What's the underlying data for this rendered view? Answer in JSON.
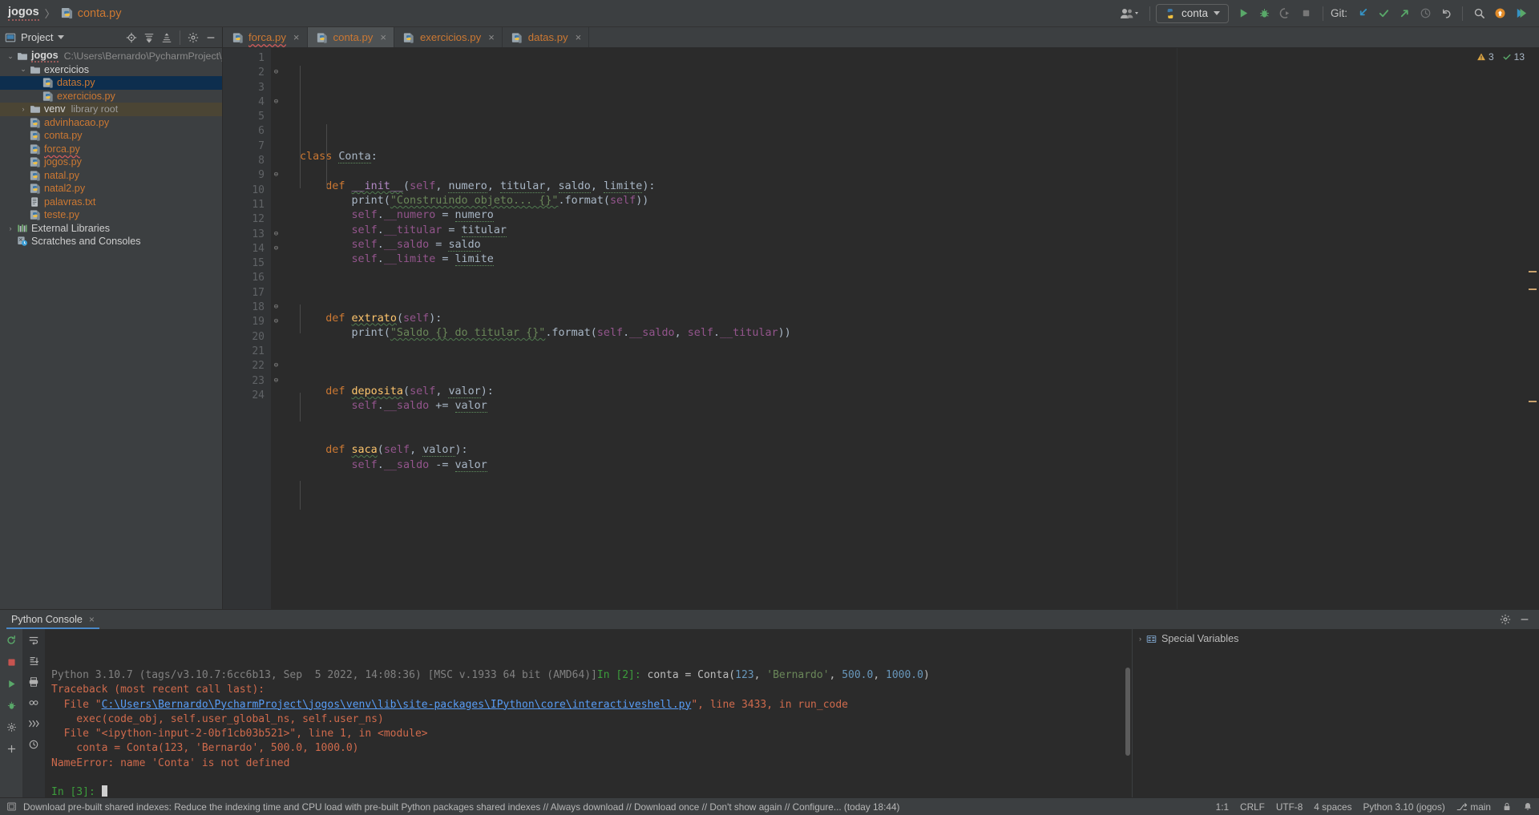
{
  "app": {
    "breadcrumb": {
      "project": "jogos",
      "separator": "〉",
      "file": "conta.py",
      "file_icon": "python-file-icon"
    },
    "run_config": {
      "label": "conta",
      "icon": "python-file-icon"
    },
    "git_label": "Git:",
    "toolbar_icons": [
      "user-account-icon",
      "run-icon",
      "debug-icon",
      "run-coverage-icon",
      "stop-icon",
      "git-update-icon",
      "git-commit-icon",
      "git-push-icon",
      "history-icon",
      "rollback-icon",
      "search-everywhere-icon",
      "notifications-update-icon",
      "plugin-icon"
    ]
  },
  "project_panel": {
    "title": "Project",
    "header_icons": [
      "locate-icon",
      "collapse-all-icon",
      "expand-all-icon",
      "settings-icon",
      "hide-icon"
    ],
    "items": [
      {
        "label": "jogos",
        "sub": "C:\\Users\\Bernardo\\PycharmProject\\jogos",
        "type": "root",
        "icon": "folder-icon",
        "indent": 0,
        "arrow": "⌄",
        "state": "normal"
      },
      {
        "label": "exercicios",
        "sub": "",
        "type": "folder",
        "icon": "folder-icon",
        "indent": 1,
        "arrow": "⌄",
        "state": "normal"
      },
      {
        "label": "datas.py",
        "sub": "",
        "type": "py",
        "icon": "python-file-icon",
        "indent": 2,
        "arrow": "",
        "state": "selected"
      },
      {
        "label": "exercicios.py",
        "sub": "",
        "type": "py",
        "icon": "python-file-icon",
        "indent": 2,
        "arrow": "",
        "state": "normal"
      },
      {
        "label": "venv",
        "sub": "library root",
        "type": "folder",
        "icon": "folder-icon",
        "indent": 1,
        "arrow": "›",
        "state": "highlight"
      },
      {
        "label": "advinhacao.py",
        "sub": "",
        "type": "py",
        "icon": "python-file-icon",
        "indent": 1,
        "arrow": "",
        "state": "normal"
      },
      {
        "label": "conta.py",
        "sub": "",
        "type": "py",
        "icon": "python-file-icon",
        "indent": 1,
        "arrow": "",
        "state": "normal"
      },
      {
        "label": "forca.py",
        "sub": "",
        "type": "py",
        "icon": "python-file-icon",
        "indent": 1,
        "arrow": "",
        "state": "error"
      },
      {
        "label": "jogos.py",
        "sub": "",
        "type": "py",
        "icon": "python-file-icon",
        "indent": 1,
        "arrow": "",
        "state": "normal"
      },
      {
        "label": "natal.py",
        "sub": "",
        "type": "py",
        "icon": "python-file-icon",
        "indent": 1,
        "arrow": "",
        "state": "normal"
      },
      {
        "label": "natal2.py",
        "sub": "",
        "type": "py",
        "icon": "python-file-icon",
        "indent": 1,
        "arrow": "",
        "state": "normal"
      },
      {
        "label": "palavras.txt",
        "sub": "",
        "type": "txt",
        "icon": "text-file-icon",
        "indent": 1,
        "arrow": "",
        "state": "normal"
      },
      {
        "label": "teste.py",
        "sub": "",
        "type": "py",
        "icon": "python-file-icon",
        "indent": 1,
        "arrow": "",
        "state": "normal"
      },
      {
        "label": "External Libraries",
        "sub": "",
        "type": "plain",
        "icon": "libraries-icon",
        "indent": 0,
        "arrow": "›",
        "state": "normal"
      },
      {
        "label": "Scratches and Consoles",
        "sub": "",
        "type": "plain",
        "icon": "scratches-icon",
        "indent": 0,
        "arrow": "",
        "state": "normal"
      }
    ]
  },
  "editor": {
    "tabs": [
      {
        "label": "forca.py",
        "icon": "python-file-icon",
        "active": false,
        "error": true
      },
      {
        "label": "conta.py",
        "icon": "python-file-icon",
        "active": true,
        "error": false
      },
      {
        "label": "exercicios.py",
        "icon": "python-file-icon",
        "active": false,
        "error": false
      },
      {
        "label": "datas.py",
        "icon": "python-file-icon",
        "active": false,
        "error": false
      }
    ],
    "inspections": {
      "warnings": "3",
      "warning_icon": "warning-triangle-icon",
      "checks": "13",
      "check_icon": "checkmark-icon"
    },
    "line_numbers": [
      "1",
      "2",
      "3",
      "4",
      "5",
      "6",
      "7",
      "8",
      "9",
      "10",
      "11",
      "12",
      "13",
      "14",
      "15",
      "16",
      "17",
      "18",
      "19",
      "20",
      "21",
      "22",
      "23",
      "24"
    ],
    "fold_lines": {
      "2": "⊖",
      "4": "⊖",
      "9": "⊖",
      "13": "⊖",
      "14": "⊖",
      "18": "⊖",
      "19": "⊖",
      "22": "⊖",
      "23": "⊖"
    },
    "code_lines": [
      "",
      "class Conta:",
      "",
      "    def __init__(self, numero, titular, saldo, limite):",
      "        print(\"Construindo objeto... {}\".format(self))",
      "        self.__numero = numero",
      "        self.__titular = titular",
      "        self.__saldo = saldo",
      "        self.__limite = limite",
      "",
      "",
      "",
      "    def extrato(self):",
      "        print(\"Saldo {} do titular {}\".format(self.__saldo, self.__titular))",
      "",
      "",
      "",
      "    def deposita(self, valor):",
      "        self.__saldo += valor",
      "",
      "",
      "    def saca(self, valor):",
      "        self.__saldo -= valor",
      ""
    ]
  },
  "console": {
    "tab_label": "Python Console",
    "tab_close": "×",
    "tools": [
      "settings-icon",
      "hide-icon"
    ],
    "left_icons": [
      "rerun-icon",
      "stop-icon",
      "execute-icon",
      "debug-icon",
      "settings-icon",
      "add-icon"
    ],
    "left_icons2": [
      "soft-wrap-icon",
      "scroll-to-end-icon",
      "print-icon",
      "show-variables-icon",
      "show-prompt-icon",
      "history-icon"
    ],
    "lines": [
      {
        "type": "banner",
        "text": "Python 3.10.7 (tags/v3.10.7:6cc6b13, Sep  5 2022, 14:08:36) [MSC v.1933 64 bit (AMD64)]",
        "prompt": "In [2]:",
        "cmd": "conta = Conta(",
        "cmd_args": "123, 'Bernardo', 500.0, 1000.0)"
      },
      {
        "type": "error",
        "text": "Traceback (most recent call last):"
      },
      {
        "type": "file",
        "prefix": "  File \"",
        "link": "C:\\Users\\Bernardo\\PycharmProject\\jogos\\venv\\lib\\site-packages\\IPython\\core\\interactiveshell.py",
        "suffix": "\", line 3433, in run_code"
      },
      {
        "type": "error",
        "text": "    exec(code_obj, self.user_global_ns, self.user_ns)"
      },
      {
        "type": "error",
        "text": "  File \"<ipython-input-2-0bf1cb03b521>\", line 1, in <module>"
      },
      {
        "type": "error",
        "text": "    conta = Conta(123, 'Bernardo', 500.0, 1000.0)"
      },
      {
        "type": "error",
        "text": "NameError: name 'Conta' is not defined"
      },
      {
        "type": "blank",
        "text": ""
      },
      {
        "type": "prompt",
        "text": "In [3]:"
      }
    ],
    "special_variables": {
      "label": "Special Variables",
      "arrow": "›",
      "icon": "variables-icon"
    }
  },
  "statusbar": {
    "message": "Download pre-built shared indexes: Reduce the indexing time and CPU load with pre-built Python packages shared indexes // Always download // Download once // Don't show again // Configure... (today 18:44)",
    "left_icon": "event-log-icon",
    "right": [
      {
        "name": "caret-position",
        "label": "1:1"
      },
      {
        "name": "line-separator",
        "label": "CRLF"
      },
      {
        "name": "file-encoding",
        "label": "UTF-8"
      },
      {
        "name": "indent-size",
        "label": "4 spaces"
      },
      {
        "name": "python-interpreter",
        "label": "Python 3.10 (jogos)"
      },
      {
        "name": "git-branch",
        "label": "main",
        "icon": "branch-icon"
      }
    ],
    "lock_icon": "lock-icon",
    "notification_icon": "bell-icon"
  },
  "colors": {
    "bg_panel": "#3c3f41",
    "bg_editor": "#2b2b2b",
    "accent_orange": "#cc7832",
    "accent_green": "#6a8759",
    "accent_blue": "#6897bb",
    "selection_blue": "#0d2e4e",
    "tab_active": "#4e5254"
  }
}
